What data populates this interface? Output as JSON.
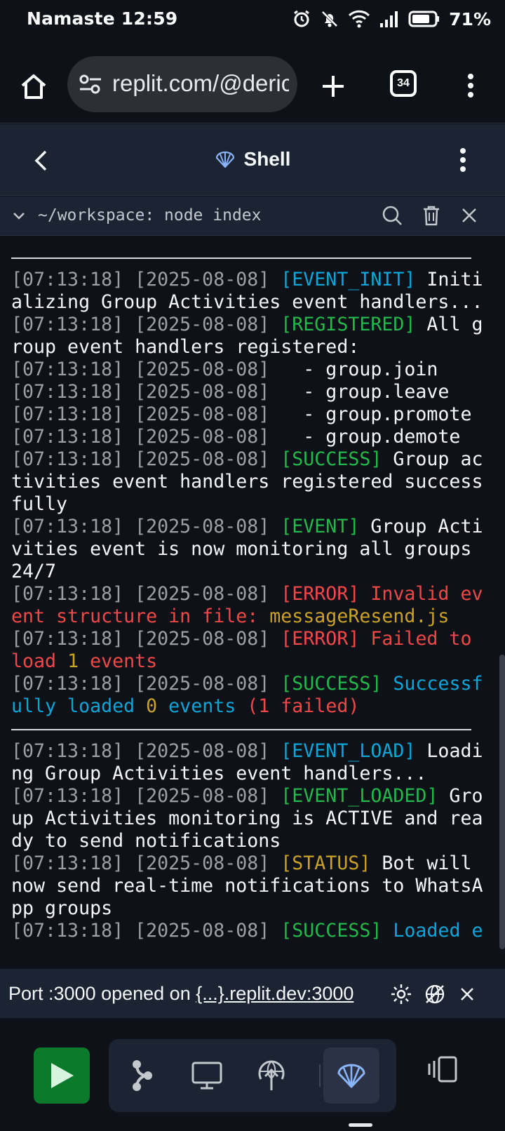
{
  "status_bar": {
    "time": "Namaste 12:59",
    "battery_percent": "71%"
  },
  "browser": {
    "url": "replit.com/@deric",
    "tab_count": "34"
  },
  "shell": {
    "title": "Shell"
  },
  "command_bar": {
    "path": "~/workspace:",
    "command": " node index"
  },
  "terminal": {
    "lines": [
      {
        "type": "sep"
      },
      {
        "type": "line",
        "segments": [
          {
            "t": "[07:13:18] [2025-08-08] ",
            "c": "ts"
          },
          {
            "t": "[EVENT_INIT]",
            "c": "cy"
          },
          {
            "t": " Initi",
            "c": "w"
          }
        ]
      },
      {
        "type": "line",
        "segments": [
          {
            "t": "alizing Group Activities event handlers...",
            "c": "w"
          }
        ]
      },
      {
        "type": "line",
        "segments": [
          {
            "t": "[07:13:18] [2025-08-08] ",
            "c": "ts"
          },
          {
            "t": "[REGISTERED]",
            "c": "gr"
          },
          {
            "t": " All g",
            "c": "w"
          }
        ]
      },
      {
        "type": "line",
        "segments": [
          {
            "t": "roup event handlers registered:",
            "c": "w"
          }
        ]
      },
      {
        "type": "line",
        "segments": [
          {
            "t": "[07:13:18] [2025-08-08] ",
            "c": "ts"
          },
          {
            "t": "  - group.join",
            "c": "w"
          }
        ]
      },
      {
        "type": "line",
        "segments": [
          {
            "t": "[07:13:18] [2025-08-08] ",
            "c": "ts"
          },
          {
            "t": "  - group.leave",
            "c": "w"
          }
        ]
      },
      {
        "type": "line",
        "segments": [
          {
            "t": "[07:13:18] [2025-08-08] ",
            "c": "ts"
          },
          {
            "t": "  - group.promote",
            "c": "w"
          }
        ]
      },
      {
        "type": "line",
        "segments": [
          {
            "t": "[07:13:18] [2025-08-08] ",
            "c": "ts"
          },
          {
            "t": "  - group.demote",
            "c": "w"
          }
        ]
      },
      {
        "type": "line",
        "segments": [
          {
            "t": "[07:13:18] [2025-08-08] ",
            "c": "ts"
          },
          {
            "t": "[SUCCESS]",
            "c": "gr"
          },
          {
            "t": " Group ac",
            "c": "w"
          }
        ]
      },
      {
        "type": "line",
        "segments": [
          {
            "t": "tivities event handlers registered success",
            "c": "w"
          }
        ]
      },
      {
        "type": "line",
        "segments": [
          {
            "t": "fully",
            "c": "w"
          }
        ]
      },
      {
        "type": "line",
        "segments": [
          {
            "t": "[07:13:18] [2025-08-08] ",
            "c": "ts"
          },
          {
            "t": "[EVENT]",
            "c": "gr"
          },
          {
            "t": " Group Acti",
            "c": "w"
          }
        ]
      },
      {
        "type": "line",
        "segments": [
          {
            "t": "vities event is now monitoring all groups",
            "c": "w"
          }
        ]
      },
      {
        "type": "line",
        "segments": [
          {
            "t": "24/7",
            "c": "w"
          }
        ]
      },
      {
        "type": "line",
        "segments": [
          {
            "t": "[07:13:18] [2025-08-08] ",
            "c": "ts"
          },
          {
            "t": "[ERROR] Invalid ev",
            "c": "rd"
          }
        ]
      },
      {
        "type": "line",
        "segments": [
          {
            "t": "ent structure in file: ",
            "c": "rd"
          },
          {
            "t": "messageResend.js",
            "c": "ye"
          }
        ]
      },
      {
        "type": "line",
        "segments": [
          {
            "t": "[07:13:18] [2025-08-08] ",
            "c": "ts"
          },
          {
            "t": "[ERROR] Failed to",
            "c": "rd"
          }
        ]
      },
      {
        "type": "line",
        "segments": [
          {
            "t": "load ",
            "c": "rd"
          },
          {
            "t": "1",
            "c": "ye"
          },
          {
            "t": " events",
            "c": "rd"
          }
        ]
      },
      {
        "type": "line",
        "segments": [
          {
            "t": "[07:13:18] [2025-08-08] ",
            "c": "ts"
          },
          {
            "t": "[SUCCESS]",
            "c": "gr"
          },
          {
            "t": " Successf",
            "c": "cy"
          }
        ]
      },
      {
        "type": "line",
        "segments": [
          {
            "t": "ully loaded ",
            "c": "cy"
          },
          {
            "t": "0",
            "c": "ye"
          },
          {
            "t": " events ",
            "c": "cy"
          },
          {
            "t": "(1 failed)",
            "c": "rd"
          }
        ]
      },
      {
        "type": "sep"
      },
      {
        "type": "line",
        "segments": [
          {
            "t": "[07:13:18] [2025-08-08] ",
            "c": "ts"
          },
          {
            "t": "[EVENT_LOAD]",
            "c": "cy"
          },
          {
            "t": " Loadi",
            "c": "w"
          }
        ]
      },
      {
        "type": "line",
        "segments": [
          {
            "t": "ng Group Activities event handlers...",
            "c": "w"
          }
        ]
      },
      {
        "type": "line",
        "segments": [
          {
            "t": "[07:13:18] [2025-08-08] ",
            "c": "ts"
          },
          {
            "t": "[EVENT_LOADED]",
            "c": "gr"
          },
          {
            "t": " Gro",
            "c": "w"
          }
        ]
      },
      {
        "type": "line",
        "segments": [
          {
            "t": "up Activities monitoring is ACTIVE and rea",
            "c": "w"
          }
        ]
      },
      {
        "type": "line",
        "segments": [
          {
            "t": "dy to send notifications",
            "c": "w"
          }
        ]
      },
      {
        "type": "line",
        "segments": [
          {
            "t": "[07:13:18] [2025-08-08] ",
            "c": "ts"
          },
          {
            "t": "[STATUS]",
            "c": "ye"
          },
          {
            "t": " Bot will",
            "c": "w"
          }
        ]
      },
      {
        "type": "line",
        "segments": [
          {
            "t": "now send real-time notifications to WhatsA",
            "c": "w"
          }
        ]
      },
      {
        "type": "line",
        "segments": [
          {
            "t": "pp groups",
            "c": "w"
          }
        ]
      },
      {
        "type": "line",
        "segments": [
          {
            "t": "[07:13:18] [2025-08-08] ",
            "c": "ts"
          },
          {
            "t": "[SUCCESS]",
            "c": "gr"
          },
          {
            "t": " Loaded e",
            "c": "cy"
          }
        ]
      }
    ]
  },
  "port_notice": {
    "prefix": "Port :3000 opened on ",
    "link": "{...}.replit.dev:3000"
  },
  "colors": {
    "background": "#0e1117",
    "panel": "#1c2333",
    "run_green": "#0b7a2a",
    "cyan": "#0aa6d9",
    "green": "#22b84a",
    "red": "#f04848",
    "yellow": "#c9a227"
  }
}
